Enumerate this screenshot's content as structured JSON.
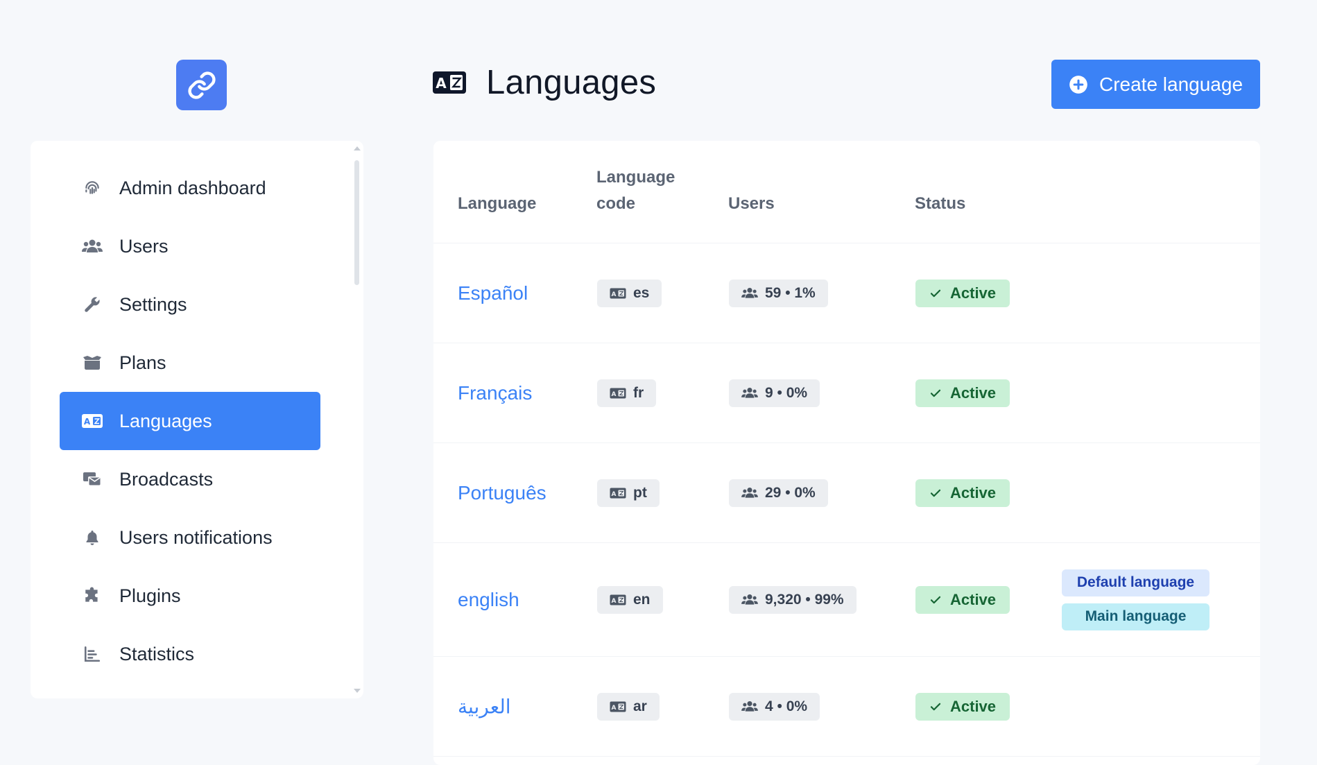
{
  "header": {
    "title": "Languages",
    "create_button": "Create language"
  },
  "sidebar": {
    "items": [
      {
        "label": "Admin dashboard",
        "icon": "fingerprint-icon"
      },
      {
        "label": "Users",
        "icon": "users-icon"
      },
      {
        "label": "Settings",
        "icon": "wrench-icon"
      },
      {
        "label": "Plans",
        "icon": "box-icon"
      },
      {
        "label": "Languages",
        "icon": "language-icon",
        "active": true
      },
      {
        "label": "Broadcasts",
        "icon": "broadcast-icon"
      },
      {
        "label": "Users notifications",
        "icon": "bell-icon"
      },
      {
        "label": "Plugins",
        "icon": "puzzle-icon"
      },
      {
        "label": "Statistics",
        "icon": "chart-icon"
      }
    ]
  },
  "table": {
    "columns": {
      "language": "Language",
      "code_line1": "Language",
      "code_line2": "code",
      "users": "Users",
      "status": "Status"
    },
    "rows": [
      {
        "name": "Español",
        "code": "es",
        "users": "59 • 1%",
        "status": "Active"
      },
      {
        "name": "Français",
        "code": "fr",
        "users": "9 • 0%",
        "status": "Active"
      },
      {
        "name": "Português",
        "code": "pt",
        "users": "29 • 0%",
        "status": "Active"
      },
      {
        "name": "english",
        "code": "en",
        "users": "9,320 • 99%",
        "status": "Active",
        "default_badge": "Default language",
        "main_badge": "Main language"
      },
      {
        "name": "العربية",
        "code": "ar",
        "users": "4 • 0%",
        "status": "Active"
      }
    ]
  },
  "colors": {
    "accent": "#3b82f6",
    "logo": "#4d7cf2",
    "status_bg": "#c9f0d6",
    "status_text": "#166534",
    "default_badge_bg": "#dbe8fd",
    "main_badge_bg": "#bfeef7"
  }
}
